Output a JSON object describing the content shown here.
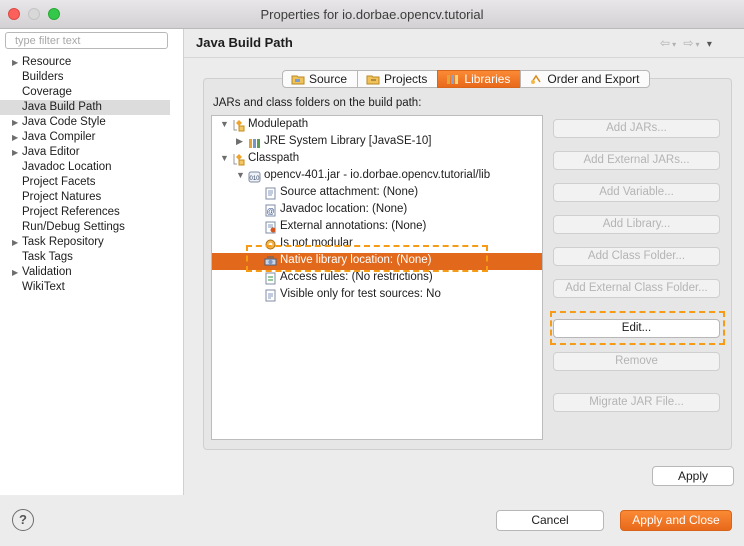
{
  "window": {
    "title": "Properties for io.dorbae.opencv.tutorial",
    "colors": {
      "close": "#fc605b",
      "minimize": "#d8d8d8",
      "zoom": "#34c84a",
      "accent": "#e8691a",
      "highlight_box": "#f59b14"
    }
  },
  "filter": {
    "placeholder": "type filter text"
  },
  "sidebar": {
    "items": [
      {
        "label": "Resource",
        "expandable": true
      },
      {
        "label": "Builders",
        "expandable": false
      },
      {
        "label": "Coverage",
        "expandable": false
      },
      {
        "label": "Java Build Path",
        "expandable": false,
        "selected": true
      },
      {
        "label": "Java Code Style",
        "expandable": true
      },
      {
        "label": "Java Compiler",
        "expandable": true
      },
      {
        "label": "Java Editor",
        "expandable": true
      },
      {
        "label": "Javadoc Location",
        "expandable": false
      },
      {
        "label": "Project Facets",
        "expandable": false
      },
      {
        "label": "Project Natures",
        "expandable": false
      },
      {
        "label": "Project References",
        "expandable": false
      },
      {
        "label": "Run/Debug Settings",
        "expandable": false
      },
      {
        "label": "Task Repository",
        "expandable": true
      },
      {
        "label": "Task Tags",
        "expandable": false
      },
      {
        "label": "Validation",
        "expandable": true
      },
      {
        "label": "WikiText",
        "expandable": false
      }
    ]
  },
  "page": {
    "title": "Java Build Path",
    "tabs": [
      {
        "label": "Source",
        "icon": "source-folder-icon"
      },
      {
        "label": "Projects",
        "icon": "projects-folder-icon"
      },
      {
        "label": "Libraries",
        "icon": "libraries-icon",
        "active": true
      },
      {
        "label": "Order and Export",
        "icon": "order-export-icon"
      }
    ],
    "list_label": "JARs and class folders on the build path:",
    "tree": [
      {
        "label": "Modulepath",
        "icon": "modulepath-icon",
        "toggle": "▼",
        "level": 0
      },
      {
        "label": "JRE System Library [JavaSE-10]",
        "icon": "library-icon",
        "toggle": "▶",
        "level": 1
      },
      {
        "label": "Classpath",
        "icon": "classpath-icon",
        "toggle": "▼",
        "level": 0
      },
      {
        "label": "opencv-401.jar - io.dorbae.opencv.tutorial/lib",
        "icon": "jar-icon",
        "toggle": "▼",
        "level": 1
      },
      {
        "label": "Source attachment: (None)",
        "icon": "source-attachment-icon",
        "toggle": "",
        "level": 2
      },
      {
        "label": "Javadoc location: (None)",
        "icon": "javadoc-icon",
        "toggle": "",
        "level": 2
      },
      {
        "label": "External annotations: (None)",
        "icon": "annotations-icon",
        "toggle": "",
        "level": 2
      },
      {
        "label": "Is not modular",
        "icon": "module-icon",
        "toggle": "",
        "level": 2
      },
      {
        "label": "Native library location: (None)",
        "icon": "native-library-icon",
        "toggle": "",
        "level": 2,
        "selected": true
      },
      {
        "label": "Access rules: (No restrictions)",
        "icon": "access-rules-icon",
        "toggle": "",
        "level": 2
      },
      {
        "label": "Visible only for test sources: No",
        "icon": "test-sources-icon",
        "toggle": "",
        "level": 2
      }
    ],
    "buttons": [
      {
        "label": "Add JARs...",
        "enabled": false
      },
      {
        "label": "Add External JARs...",
        "enabled": false
      },
      {
        "label": "Add Variable...",
        "enabled": false
      },
      {
        "label": "Add Library...",
        "enabled": false
      },
      {
        "label": "Add Class Folder...",
        "enabled": false
      },
      {
        "label": "Add External Class Folder...",
        "enabled": false
      },
      {
        "label": "Edit...",
        "enabled": true
      },
      {
        "label": "Remove",
        "enabled": false
      },
      {
        "label": "Migrate JAR File...",
        "enabled": false
      }
    ],
    "apply_label": "Apply"
  },
  "footer": {
    "help_label": "?",
    "cancel_label": "Cancel",
    "apply_close_label": "Apply and Close"
  }
}
